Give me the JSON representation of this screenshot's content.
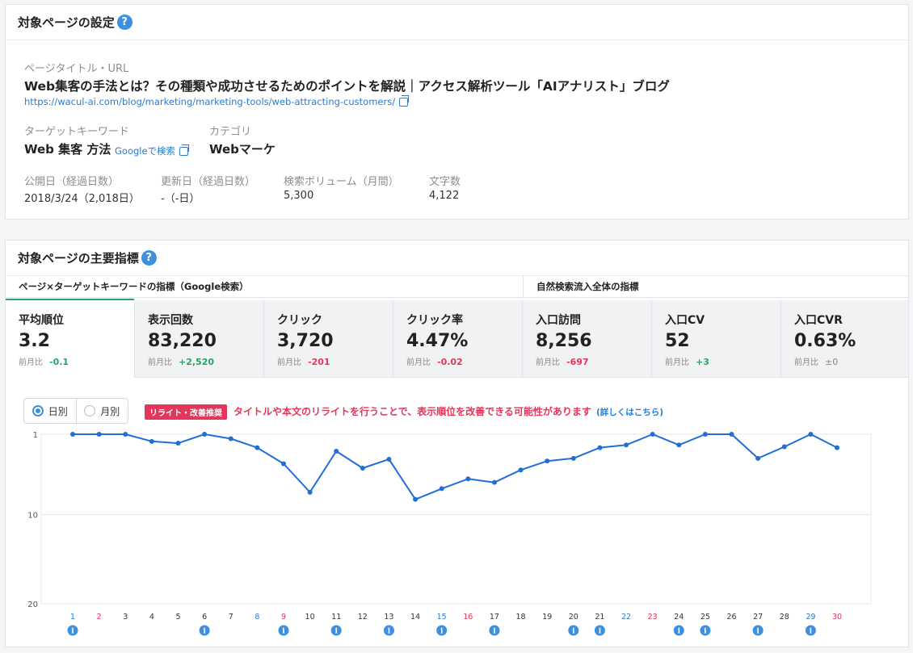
{
  "settings": {
    "title": "対象ページの設定",
    "help": "?",
    "page_title_label": "ページタイトル・URL",
    "page_title": "Web集客の手法とは？その種類や成功させるためのポイントを解説｜アクセス解析ツール「AIアナリスト」ブログ",
    "url": "https://wacul-ai.com/blog/marketing/marketing-tools/web-attracting-customers/",
    "keyword_label": "ターゲットキーワード",
    "keyword": "Web 集客 方法",
    "google_search": "Googleで検索",
    "category_label": "カテゴリ",
    "category": "Webマーケ",
    "published_label": "公開日（経過日数）",
    "published": "2018/3/24（2,018日）",
    "updated_label": "更新日（経過日数）",
    "updated": "-（-日）",
    "volume_label": "検索ボリューム（月間）",
    "volume": "5,300",
    "chars_label": "文字数",
    "chars": "4,122"
  },
  "metrics_section": {
    "title": "対象ページの主要指標",
    "help": "?",
    "tab_a": "ページ×ターゲットキーワードの指標（Google検索）",
    "tab_b": "自然検索流入全体の指標",
    "prev_label": "前月比",
    "metrics": [
      {
        "label": "平均順位",
        "value": "3.2",
        "diff": "-0.1",
        "tone": "pos"
      },
      {
        "label": "表示回数",
        "value": "83,220",
        "diff": "+2,520",
        "tone": "pos"
      },
      {
        "label": "クリック",
        "value": "3,720",
        "diff": "-201",
        "tone": "neg"
      },
      {
        "label": "クリック率",
        "value": "4.47%",
        "diff": "-0.02",
        "tone": "neg"
      },
      {
        "label": "入口訪問",
        "value": "8,256",
        "diff": "-697",
        "tone": "neg"
      },
      {
        "label": "入口CV",
        "value": "52",
        "diff": "+3",
        "tone": "pos"
      },
      {
        "label": "入口CVR",
        "value": "0.63%",
        "diff": "±0",
        "tone": "neu"
      }
    ],
    "toggle_daily": "日別",
    "toggle_monthly": "月別",
    "badge": "リライト・改善推奨",
    "notice": "タイトルや本文のリライトを行うことで、表示順位を改善できる可能性があります",
    "notice_link": "(詳しくはこちら)"
  },
  "chart_data": {
    "type": "line",
    "title": "",
    "xlabel": "",
    "ylabel": "",
    "ylim": [
      1,
      20
    ],
    "y_inverted": true,
    "yticks": [
      1,
      10,
      20
    ],
    "grid": true,
    "x": [
      1,
      2,
      3,
      4,
      5,
      6,
      7,
      8,
      9,
      10,
      11,
      12,
      13,
      14,
      15,
      16,
      17,
      18,
      19,
      20,
      21,
      22,
      23,
      24,
      25,
      26,
      27,
      28,
      29,
      30
    ],
    "series": [
      {
        "values": [
          1.0,
          1.0,
          1.0,
          1.8,
          2.0,
          1.0,
          1.5,
          2.5,
          4.3,
          7.5,
          2.9,
          4.8,
          3.8,
          8.3,
          7.1,
          6.0,
          6.4,
          5.0,
          4.0,
          3.7,
          2.5,
          2.2,
          1.0,
          2.2,
          1.0,
          1.0,
          3.7,
          2.4,
          1.0,
          2.5
        ],
        "color": "#1f6fd6"
      }
    ],
    "x_label_colors": {
      "1": "#2a7bd2",
      "2": "#e3365b",
      "8": "#2a7bd2",
      "9": "#e3365b",
      "15": "#2a7bd2",
      "16": "#e3365b",
      "22": "#2a7bd2",
      "23": "#e3365b",
      "29": "#2a7bd2",
      "30": "#e3365b"
    },
    "info_markers": [
      1,
      6,
      9,
      11,
      13,
      15,
      17,
      20,
      21,
      24,
      25,
      27,
      29
    ],
    "info_icon": "info-icon"
  }
}
